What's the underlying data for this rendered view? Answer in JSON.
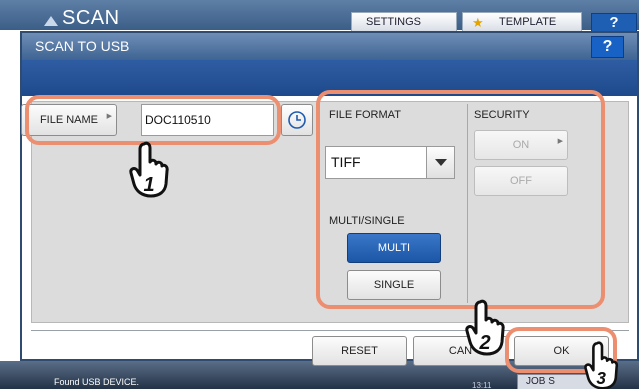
{
  "background": {
    "app_title": "SCAN",
    "settings_label": "SETTINGS",
    "template_label": "TEMPLATE",
    "help_label": "?",
    "status_text": "Found USB DEVICE.",
    "time_text": "13:11",
    "jobs_label": "JOB S"
  },
  "dialog": {
    "title": "SCAN TO USB",
    "help_label": "?"
  },
  "file": {
    "name_button_label": "FILE NAME",
    "name_value": "DOC110510"
  },
  "format": {
    "label": "FILE FORMAT",
    "selected": "TIFF"
  },
  "security": {
    "label": "SECURITY",
    "on_label": "ON",
    "off_label": "OFF"
  },
  "multi_single": {
    "label": "MULTI/SINGLE",
    "multi_label": "MULTI",
    "single_label": "SINGLE",
    "selected": "MULTI"
  },
  "actions": {
    "reset_label": "RESET",
    "cancel_label": "CAN",
    "ok_label": "OK"
  },
  "annotations": {
    "step1": "1",
    "step2": "2",
    "step3": "3",
    "highlight_color": "#ec8e70"
  }
}
